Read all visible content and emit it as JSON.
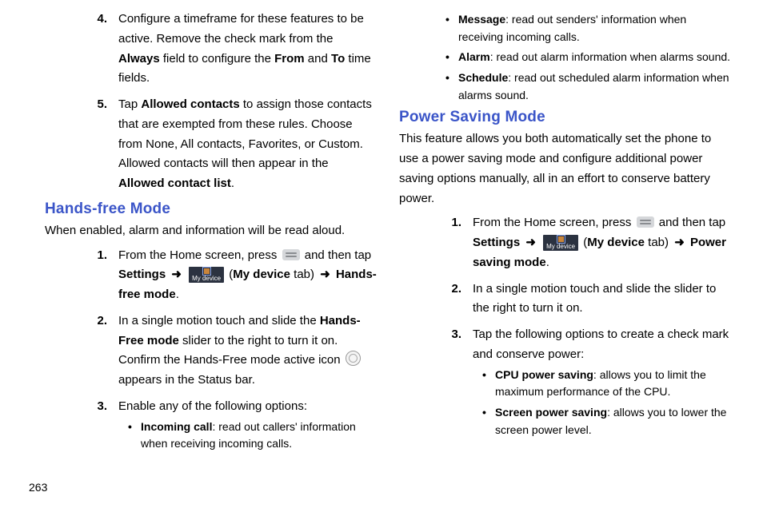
{
  "page_number": "263",
  "left": {
    "items45": [
      {
        "num": "4.",
        "pre": "Configure a timeframe for these features to be active. Remove the check mark from the ",
        "b1": "Always",
        "mid": " field to configure the ",
        "b2": "From",
        "mid2": " and ",
        "b3": "To",
        "post": " time fields."
      },
      {
        "num": "5.",
        "pre": "Tap ",
        "b1": "Allowed contacts",
        "mid": " to assign those contacts that are exempted from these rules. Choose from None, All contacts, Favorites, or Custom. Allowed contacts will then appear in the ",
        "b2": "Allowed contact list",
        "post": "."
      }
    ],
    "h2": "Hands-free Mode",
    "intro": "When enabled, alarm and information will be read aloud.",
    "steps": {
      "s1": {
        "num": "1.",
        "pre": "From the Home screen, press ",
        "post1": " and then tap ",
        "settings": "Settings",
        "arrow": "➜",
        "mydevice_label": "My device",
        "paren_pre": " (",
        "mydevice_bold": "My device",
        "paren_mid": " tab) ",
        "target": "Hands-free mode",
        "dot": "."
      },
      "s2": {
        "num": "2.",
        "pre": "In a single motion touch and slide the ",
        "b1": "Hands-Free mode",
        "mid": " slider to the right to turn it on.",
        "line2a": "Confirm the Hands-Free mode active icon ",
        "line2b": "appears in the Status bar."
      },
      "s3": {
        "num": "3.",
        "text": "Enable any of the following options:",
        "bullets": [
          {
            "b": "Incoming call",
            "rest": ": read out callers' information when receiving incoming calls."
          }
        ]
      }
    }
  },
  "right": {
    "top_bullets": [
      {
        "b": "Message",
        "rest": ": read out senders' information when receiving incoming calls."
      },
      {
        "b": "Alarm",
        "rest": ": read out alarm information when alarms sound."
      },
      {
        "b": "Schedule",
        "rest": ": read out scheduled alarm information when alarms sound."
      }
    ],
    "h2": "Power Saving Mode",
    "intro": "This feature allows you both automatically set the phone to use a power saving mode and configure additional power saving options manually, all in an effort to conserve battery power.",
    "steps": {
      "s1": {
        "num": "1.",
        "pre": "From the Home screen, press ",
        "post1": " and then tap ",
        "settings": "Settings",
        "arrow": "➜",
        "mydevice_label": "My device",
        "paren_pre": " (",
        "mydevice_bold": "My device",
        "paren_mid": " tab) ",
        "target": "Power saving mode",
        "dot": "."
      },
      "s2": {
        "num": "2.",
        "text": "In a single motion touch and slide the slider to the right to turn it on."
      },
      "s3": {
        "num": "3.",
        "text": "Tap the following options to create a check mark and conserve power:",
        "bullets": [
          {
            "b": "CPU power saving",
            "rest": ": allows you to limit the maximum performance of the CPU."
          },
          {
            "b": "Screen power saving",
            "rest": ": allows you to lower the screen power level."
          }
        ]
      }
    }
  }
}
